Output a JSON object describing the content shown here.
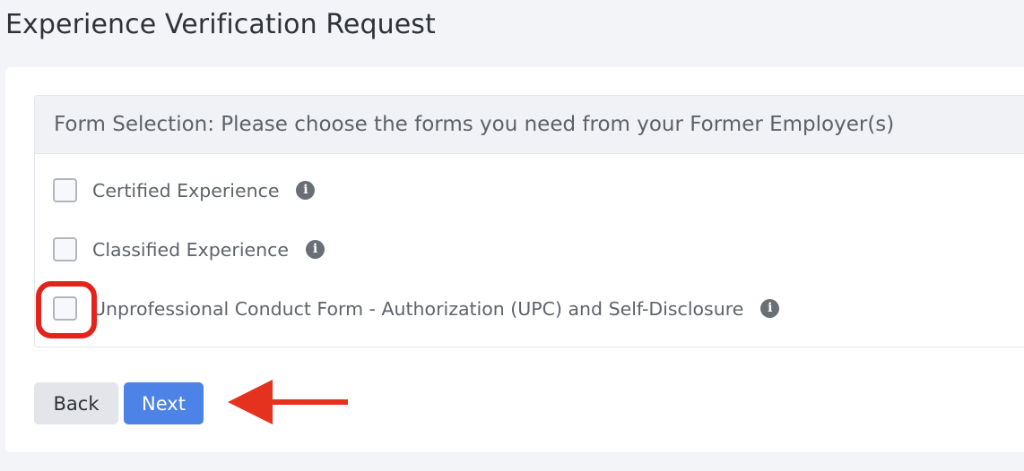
{
  "page": {
    "title": "Experience Verification Request"
  },
  "form": {
    "header": "Form Selection: Please choose the forms you need from your Former Employer(s)",
    "options": [
      {
        "label": "Certified Experience",
        "checked": false,
        "info_icon": "info-icon"
      },
      {
        "label": "Classified Experience",
        "checked": false,
        "info_icon": "info-icon"
      },
      {
        "label": "Unprofessional Conduct Form - Authorization (UPC) and Self-Disclosure",
        "checked": false,
        "info_icon": "info-icon"
      }
    ],
    "info_glyph": "i"
  },
  "buttons": {
    "back": "Back",
    "next": "Next"
  },
  "annotations": {
    "highlight_color": "#e4231d",
    "arrow_color": "#e4321f"
  },
  "colors": {
    "next_button": "#4d83e6",
    "back_button": "#e3e5ea",
    "page_background": "#f3f4f8"
  }
}
